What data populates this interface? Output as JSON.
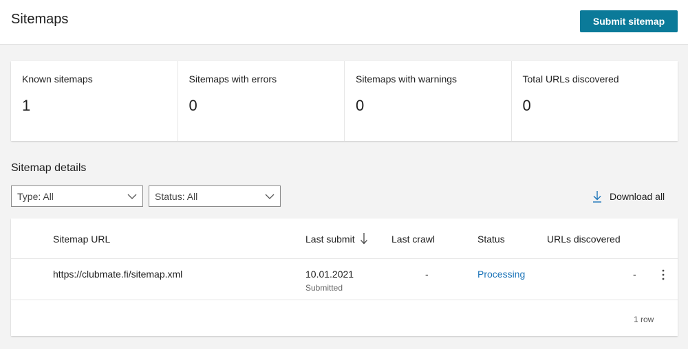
{
  "header": {
    "title": "Sitemaps",
    "submit_label": "Submit sitemap"
  },
  "stats": [
    {
      "label": "Known sitemaps",
      "value": "1"
    },
    {
      "label": "Sitemaps with errors",
      "value": "0"
    },
    {
      "label": "Sitemaps with warnings",
      "value": "0"
    },
    {
      "label": "Total URLs discovered",
      "value": "0"
    }
  ],
  "details": {
    "title": "Sitemap details",
    "filters": {
      "type": "Type: All",
      "status": "Status: All"
    },
    "download_label": "Download all"
  },
  "table": {
    "columns": {
      "url": "Sitemap URL",
      "last_submit": "Last submit",
      "last_crawl": "Last crawl",
      "status": "Status",
      "urls_discovered": "URLs discovered"
    },
    "rows": [
      {
        "url": "https://clubmate.fi/sitemap.xml",
        "last_submit": "10.01.2021",
        "last_submit_sub": "Submitted",
        "last_crawl": "-",
        "status": "Processing",
        "urls_discovered": "-"
      }
    ],
    "row_count": "1 row"
  },
  "colors": {
    "accent": "#0b7a99",
    "link": "#1a73b8",
    "background": "#f3f3f3"
  },
  "icons": {
    "filter_chevron": "chevron-down-icon",
    "download": "download-icon",
    "sort": "arrow-down-icon",
    "row_menu": "more-vertical-icon"
  }
}
